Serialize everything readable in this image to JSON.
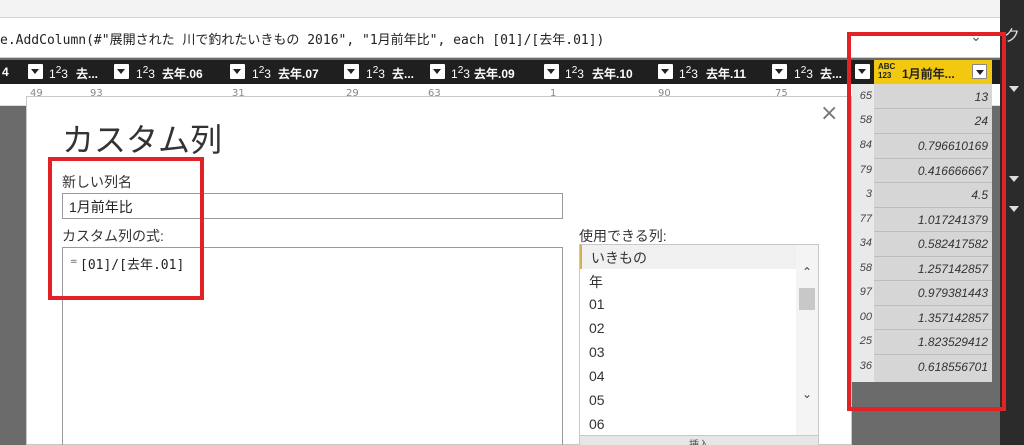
{
  "formula": {
    "text": "e.AddColumn(#\"展開された 川で釣れたいきもの 2016\", \"1月前年比\", each [01]/[去年.01])"
  },
  "columns": [
    {
      "type": "1²3",
      "name": "4"
    },
    {
      "type": "1²3",
      "name": "去..."
    },
    {
      "type": "1²3",
      "name": "去年.06"
    },
    {
      "type": "1²3",
      "name": "去年.07"
    },
    {
      "type": "1²3",
      "name": "去..."
    },
    {
      "type": "1²3",
      "name": "去年.09"
    },
    {
      "type": "1²3",
      "name": "去年.10"
    },
    {
      "type": "1²3",
      "name": "去年.11"
    },
    {
      "type": "1²3",
      "name": "去..."
    },
    {
      "type": "ABC 123",
      "name": "1月前年..."
    }
  ],
  "grid_values": [
    "49",
    "93",
    "31",
    "29",
    "63",
    "1",
    "90",
    "75"
  ],
  "dialog": {
    "title": "カスタム列",
    "new_col_label": "新しい列名",
    "new_col_value": "1月前年比",
    "formula_label": "カスタム列の式:",
    "formula_eq": "=",
    "formula_value": "[01]/[去年.01]",
    "available_label": "使用できる列:",
    "available_columns": [
      "いきもの",
      "年",
      "01",
      "02",
      "03",
      "04",
      "05",
      "06"
    ],
    "insert_label": "挿入",
    "close_glyph": "×"
  },
  "left_numbers": [
    "65",
    "58",
    "84",
    "79",
    "3",
    "77",
    "34",
    "58",
    "97",
    "00",
    "25",
    "36"
  ],
  "new_column_values": [
    "13",
    "24",
    "0.796610169",
    "0.416666667",
    "4.5",
    "1.017241379",
    "0.582417582",
    "1.257142857",
    "0.979381443",
    "1.357142857",
    "1.823529412",
    "0.618556701"
  ],
  "colors": {
    "annotation_red": "#e32225",
    "highlight_header": "#f2c811"
  }
}
